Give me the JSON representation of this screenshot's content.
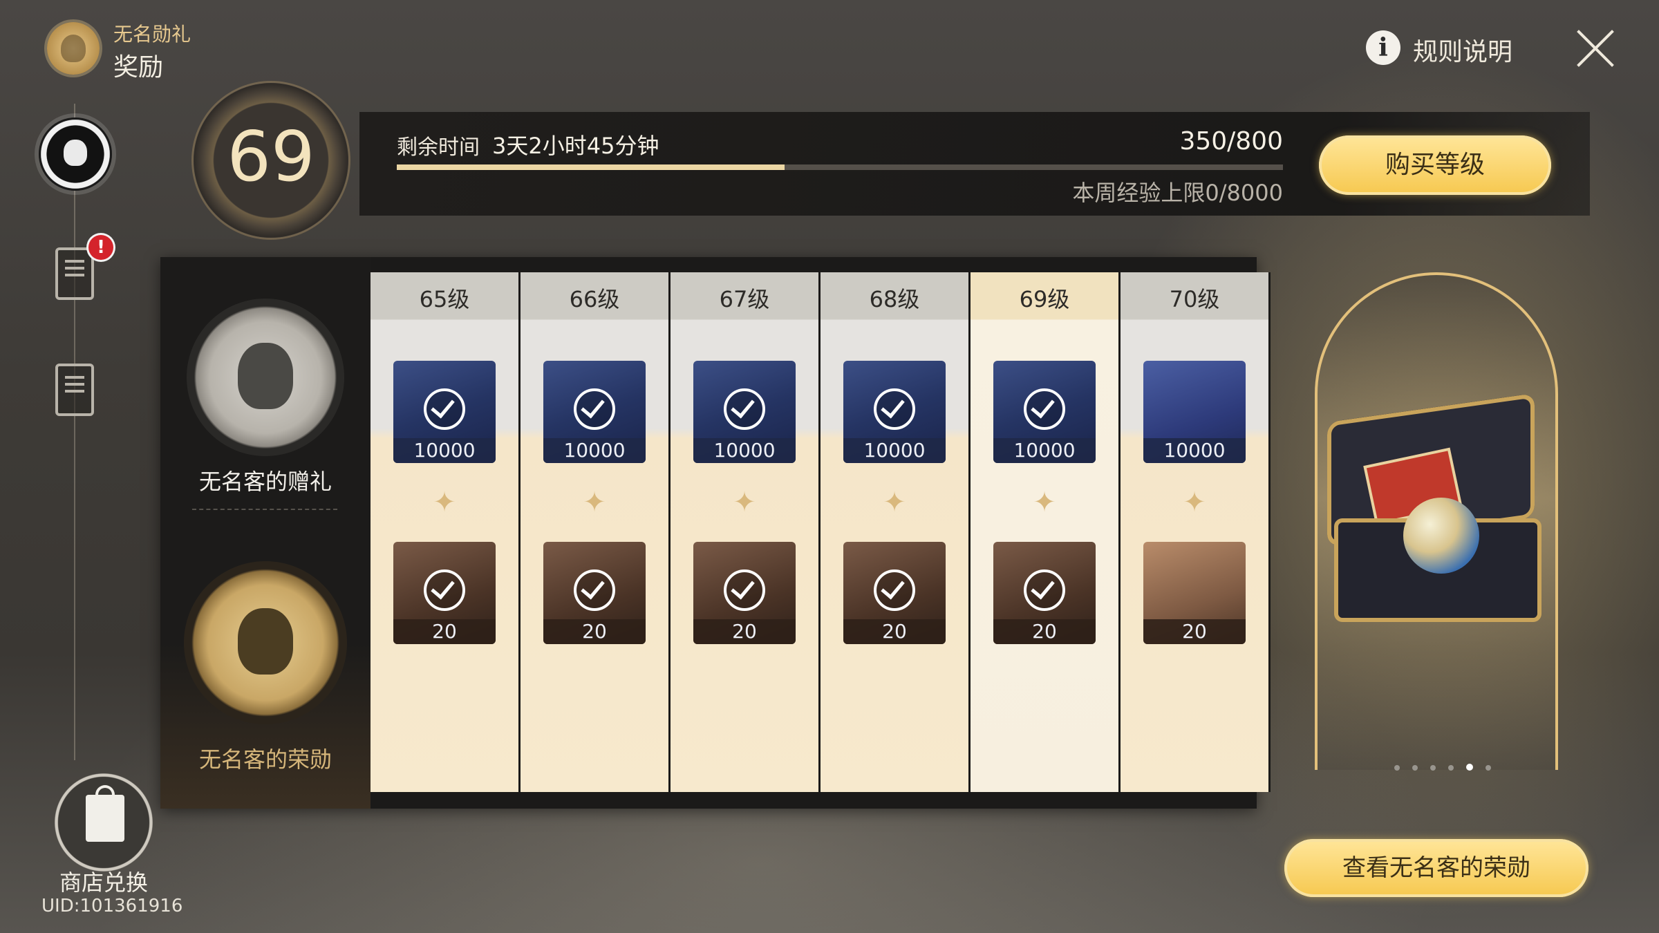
{
  "header": {
    "subtitle": "无名勋礼",
    "title": "奖励",
    "rules_label": "规则说明",
    "rules_icon": "info-icon",
    "close_icon": "close-icon"
  },
  "sidebar": {
    "tabs": [
      {
        "icon": "emblem-icon",
        "active": true
      },
      {
        "icon": "clipboard-task-icon",
        "badge": "!"
      },
      {
        "icon": "document-search-icon"
      }
    ],
    "shop_label": "商店兑换",
    "uid": "UID:101361916"
  },
  "level": {
    "current": "69",
    "time_label": "剩余时间",
    "time_value": "3天2小时45分钟",
    "exp": "350/800",
    "exp_progress": 0.4375,
    "weekly_cap": "本周经验上限0/8000",
    "buy_label": "购买等级"
  },
  "tracks": {
    "free_label": "无名客的赠礼",
    "paid_label": "无名客的荣勋"
  },
  "columns": [
    {
      "label": "65级",
      "free_qty": "10000",
      "paid_qty": "20",
      "claimed": true,
      "current": false
    },
    {
      "label": "66级",
      "free_qty": "10000",
      "paid_qty": "20",
      "claimed": true,
      "current": false
    },
    {
      "label": "67级",
      "free_qty": "10000",
      "paid_qty": "20",
      "claimed": true,
      "current": false
    },
    {
      "label": "68级",
      "free_qty": "10000",
      "paid_qty": "20",
      "claimed": true,
      "current": false
    },
    {
      "label": "69级",
      "free_qty": "10000",
      "paid_qty": "20",
      "claimed": true,
      "current": true
    },
    {
      "label": "70级",
      "free_qty": "10000",
      "paid_qty": "20",
      "claimed": false,
      "current": false
    }
  ],
  "showcase": {
    "page_count": 6,
    "active_page": 5,
    "button_label": "查看无名客的荣勋"
  },
  "colors": {
    "accent_gold": "#f6c84f",
    "progress_fill": "#ecd7a4",
    "badge_red": "#d4232b"
  }
}
